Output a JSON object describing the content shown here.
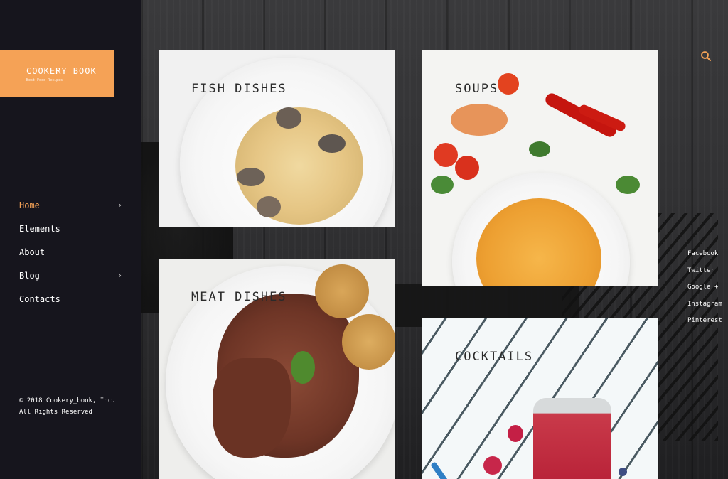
{
  "brand": {
    "title": "COOKERY BOOK",
    "tagline": "Best Food Recipes",
    "accent": "#f5a256"
  },
  "nav": {
    "items": [
      {
        "label": "Home",
        "active": true,
        "has_submenu": true
      },
      {
        "label": "Elements",
        "active": false,
        "has_submenu": false
      },
      {
        "label": "About",
        "active": false,
        "has_submenu": false
      },
      {
        "label": "Blog",
        "active": false,
        "has_submenu": true
      },
      {
        "label": "Contacts",
        "active": false,
        "has_submenu": false
      }
    ],
    "chevron": "›"
  },
  "footer": {
    "copyright": "© 2018 Cookery_book, Inc. All Rights Reserved"
  },
  "tiles": [
    {
      "title": "FISH DISHES"
    },
    {
      "title": "SOUPS"
    },
    {
      "title": "MEAT DISHES"
    },
    {
      "title": "COCKTAILS"
    }
  ],
  "search": {
    "icon": "search-icon"
  },
  "social": [
    "Facebook",
    "Twitter",
    "Google +",
    "Instagram",
    "Pinterest"
  ]
}
